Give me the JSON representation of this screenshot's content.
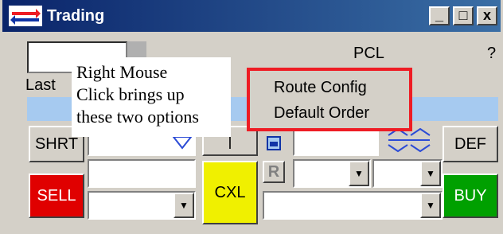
{
  "window": {
    "title": "Trading",
    "minimize_glyph": "_",
    "maximize_glyph": "□",
    "close_glyph": "x"
  },
  "toolbar": {
    "pcl_label": "PCL",
    "help_glyph": "?"
  },
  "quote": {
    "last_label": "Last"
  },
  "buttons": {
    "short": "SHRT",
    "sell": "SELL",
    "cancel": "CXL",
    "default": "DEF",
    "buy": "BUY",
    "r": "R"
  },
  "note": {
    "line1": "Right Mouse",
    "line2": "Click brings up",
    "line3": "these two options"
  },
  "context_menu": {
    "items": [
      "Route Config",
      "Default Order"
    ]
  },
  "colors": {
    "title_bar": "#0a246a",
    "sell": "#e00000",
    "buy": "#00a000",
    "cancel": "#f0f000",
    "highlight": "#ee1c24",
    "quote_bar": "#a6caf0"
  },
  "icons": [
    "arrows-icon",
    "checkbox-icon",
    "up-down-arrows-icon",
    "down-arrow-icon"
  ]
}
